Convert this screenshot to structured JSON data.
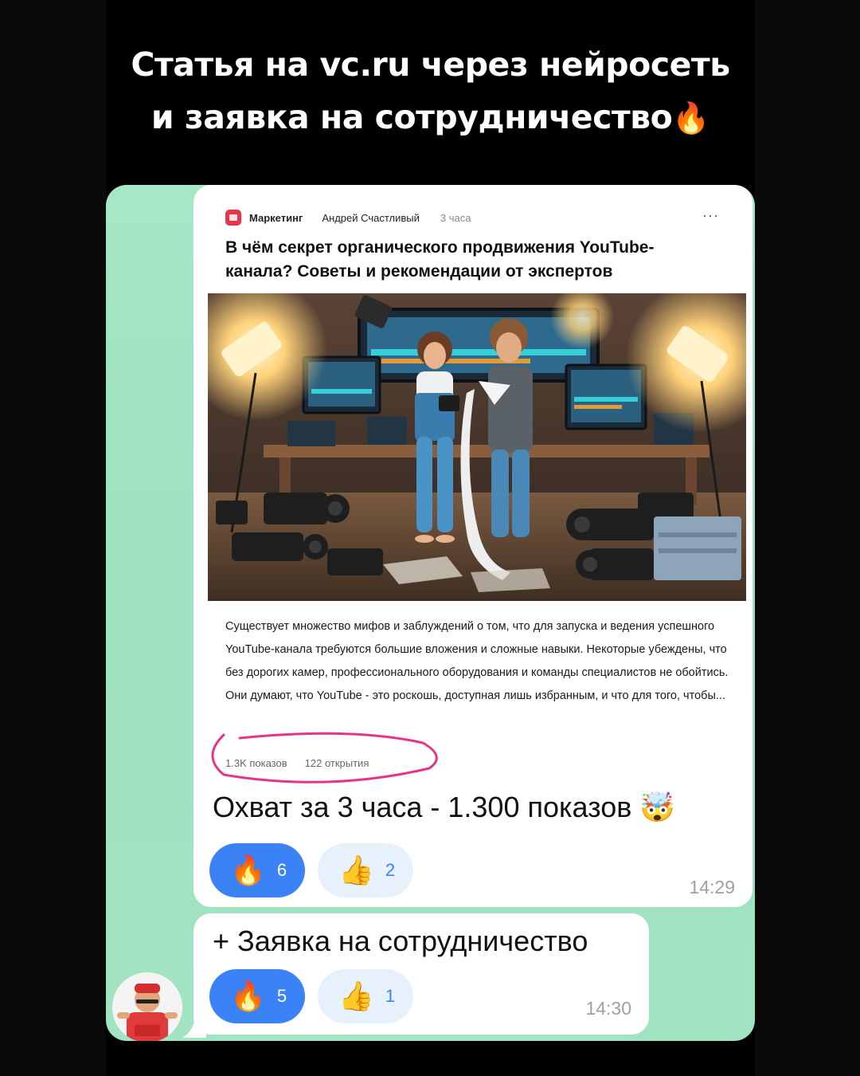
{
  "headline": {
    "line1": "Статья на vc.ru через нейросеть",
    "line2": "и заявка на сотрудничество",
    "emoji": "🔥"
  },
  "article": {
    "category": "Маркетинг",
    "author": "Андрей Счастливый",
    "time": "3 часа",
    "more": "···",
    "title": "В чём секрет органического продвижения YouTube-канала? Советы и рекомендации от экспертов",
    "excerpt": "Существует множество мифов и заблуждений о том, что для запуска и ведения успешного YouTube-канала требуются большие вложения и сложные навыки. Некоторые убеждены, что без дорогих камер, профессионального оборудования и команды специалистов не обойтись. Они думают, что YouTube - это роскошь, доступная лишь избранным, и что для того, чтобы...",
    "views": "1.3K показов",
    "opens": "122 открытия"
  },
  "messages": [
    {
      "text": "Охват за 3 часа - 1.300 показов",
      "emoji": "🤯",
      "time": "14:29",
      "reactions": [
        {
          "emoji": "🔥",
          "count": "6",
          "active": true
        },
        {
          "emoji": "👍",
          "count": "2",
          "active": false
        }
      ]
    },
    {
      "text": "+ Заявка на сотрудничество",
      "time": "14:30",
      "reactions": [
        {
          "emoji": "🔥",
          "count": "5",
          "active": true
        },
        {
          "emoji": "👍",
          "count": "1",
          "active": false
        }
      ]
    }
  ],
  "colors": {
    "chat_bg": "#a6e8c6",
    "reaction_active": "#3b82f6",
    "reaction_inactive": "#e7f1fb",
    "annotation": "#e8338a",
    "category_icon": "#e8334a"
  },
  "icons": {
    "category": "vc-category-icon",
    "avatar": "user-avatar"
  }
}
